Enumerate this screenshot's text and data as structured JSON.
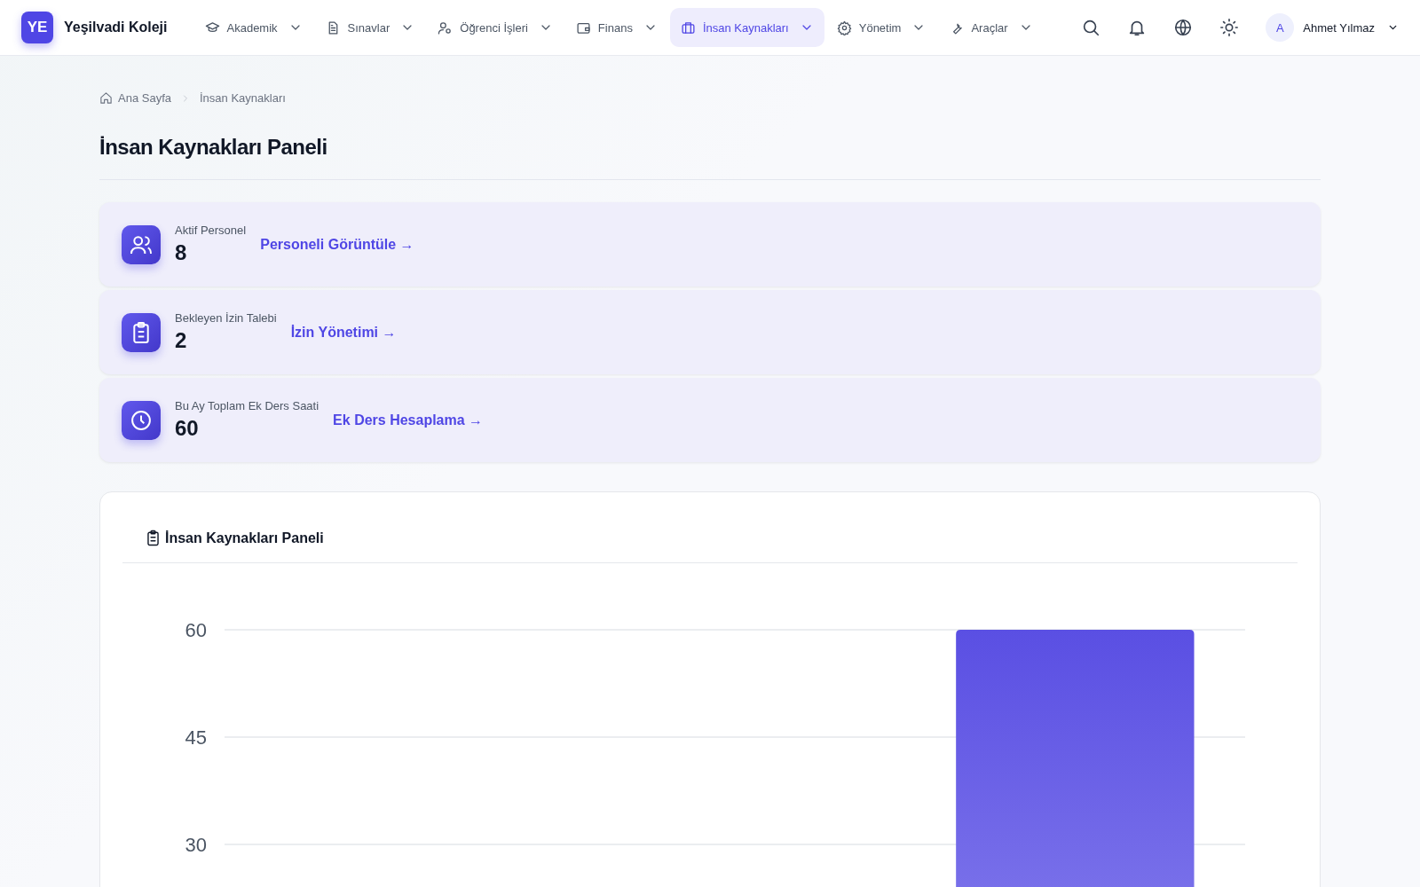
{
  "brand": {
    "logo": "YE",
    "name": "Yeşilvadi Koleji"
  },
  "nav": [
    {
      "label": "Akademik",
      "selected": false
    },
    {
      "label": "Sınavlar",
      "selected": false
    },
    {
      "label": "Öğrenci İşleri",
      "selected": false
    },
    {
      "label": "Finans",
      "selected": false
    },
    {
      "label": "İnsan Kaynakları",
      "selected": true
    },
    {
      "label": "Yönetim",
      "selected": false
    },
    {
      "label": "Araçlar",
      "selected": false
    }
  ],
  "user": {
    "initial": "A",
    "name": "Ahmet Yılmaz"
  },
  "breadcrumb": [
    "Ana Sayfa",
    "İnsan Kaynakları"
  ],
  "page_title": "İnsan Kaynakları Paneli",
  "stats": [
    {
      "label": "Aktif Personel",
      "value": "8",
      "link": "Personeli Görüntüle →"
    },
    {
      "label": "Bekleyen İzin Talebi",
      "value": "2",
      "link": "İzin Yönetimi →"
    },
    {
      "label": "Bu Ay Toplam Ek Ders Saati",
      "value": "60",
      "link": "Ek Ders Hesaplama →"
    }
  ],
  "chart_card": {
    "title": "İnsan Kaynakları Paneli",
    "chart_data": {
      "type": "bar",
      "values": [
        null,
        null,
        60
      ],
      "ylim": [
        0,
        60
      ],
      "yticks": [
        30,
        45,
        60
      ]
    }
  }
}
